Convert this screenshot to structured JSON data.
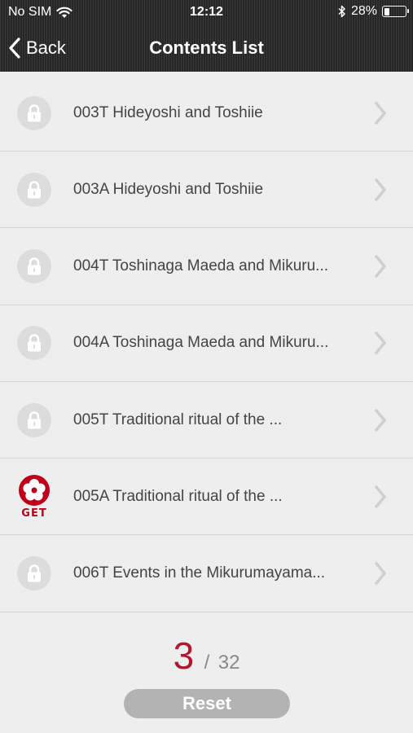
{
  "status_bar": {
    "carrier": "No SIM",
    "time": "12:12",
    "battery_percent": "28%",
    "battery_level": 0.28,
    "icons": [
      "wifi-icon",
      "bluetooth-icon",
      "battery-icon"
    ]
  },
  "navbar": {
    "back_label": "Back",
    "title": "Contents List"
  },
  "items": [
    {
      "label": "003T Hideyoshi and Toshiie",
      "status": "locked"
    },
    {
      "label": "003A Hideyoshi and Toshiie",
      "status": "locked"
    },
    {
      "label": "004T Toshinaga Maeda and Mikuru...",
      "status": "locked"
    },
    {
      "label": "004A Toshinaga Maeda and Mikuru...",
      "status": "locked"
    },
    {
      "label": "005T Traditional ritual of the ...",
      "status": "locked"
    },
    {
      "label": "005A Traditional ritual of the ...",
      "status": "get",
      "badge_text": "GET"
    },
    {
      "label": "006T Events in the Mikurumayama...",
      "status": "locked"
    }
  ],
  "counter": {
    "current": "3",
    "separator": "/",
    "total": "32"
  },
  "reset_label": "Reset",
  "colors": {
    "accent_red": "#b2172d",
    "header_bg": "#2c2c2c",
    "list_bg": "#eeeeee",
    "reset_bg": "#b3b3b3"
  }
}
